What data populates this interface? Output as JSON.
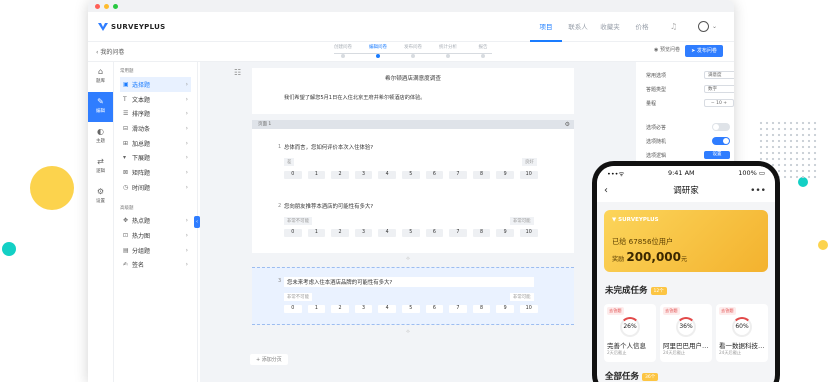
{
  "colors": {
    "accent": "#2f7dff",
    "yellow": "#fcc543",
    "teal": "#13d0c5",
    "red": "#e24a4a"
  },
  "app": {
    "logo": "SURVEYPLUS"
  },
  "topnav": {
    "tabs": [
      "项目",
      "联系人",
      "收藏夹",
      "价格"
    ],
    "active_tab": "项目"
  },
  "subbar": {
    "back_label": "我的问卷",
    "steps": [
      "创建问卷",
      "编辑问卷",
      "发布问卷",
      "统计分析",
      "报告"
    ],
    "active_step": "编辑问卷",
    "preview_label": "预览问卷",
    "publish_label": "发布问卷"
  },
  "leftnav": {
    "items": [
      {
        "label": "题库",
        "icon": "home-icon"
      },
      {
        "label": "编辑",
        "icon": "edit-icon"
      },
      {
        "label": "主题",
        "icon": "palette-icon"
      },
      {
        "label": "逻辑",
        "icon": "logic-icon"
      },
      {
        "label": "设置",
        "icon": "settings-icon"
      }
    ],
    "active": "编辑"
  },
  "qtypes": {
    "group1_title": "常用题",
    "group1": [
      {
        "label": "选择题",
        "icon": "radio-icon"
      },
      {
        "label": "文本题",
        "icon": "text-icon"
      },
      {
        "label": "排序题",
        "icon": "sort-icon"
      },
      {
        "label": "滑动条",
        "icon": "slider-icon"
      },
      {
        "label": "加总题",
        "icon": "sum-icon"
      },
      {
        "label": "下展题",
        "icon": "dropdown-icon"
      },
      {
        "label": "矩阵题",
        "icon": "matrix-icon"
      },
      {
        "label": "时间题",
        "icon": "clock-icon"
      }
    ],
    "group2_title": "高级题",
    "group2": [
      {
        "label": "热点题",
        "icon": "hotspot-icon"
      },
      {
        "label": "热力图",
        "icon": "heatmap-icon"
      },
      {
        "label": "分组题",
        "icon": "group-icon"
      },
      {
        "label": "签名",
        "icon": "signature-icon"
      }
    ],
    "active": "选择题"
  },
  "survey": {
    "title": "希尔顿酒店满意度调查",
    "description": "我们希望了解您5月1日在入住北京王府井希尔顿酒店的体验。",
    "page_label": "页面 1",
    "questions": [
      {
        "num": "1",
        "text": "总体而言，您如何评价本次入住体验?",
        "left_label": "差",
        "right_label": "良好"
      },
      {
        "num": "2",
        "text": "您向朋友推荐本酒店的可能性有多大?",
        "left_label": "非常不可能",
        "right_label": "非常可能"
      },
      {
        "num": "3",
        "text": "您未来考虑入住本酒店品牌的可能性有多大?",
        "left_label": "非常不可能",
        "right_label": "非常可能"
      }
    ],
    "scale": [
      "0",
      "1",
      "2",
      "3",
      "4",
      "5",
      "6",
      "7",
      "8",
      "9",
      "10"
    ],
    "add_page_label": "+ 添加分页"
  },
  "props": {
    "rows": [
      {
        "label": "常用选项",
        "value": "满意度"
      },
      {
        "label": "答题类型",
        "value": "数字"
      },
      {
        "label": "量程",
        "value": "10"
      }
    ],
    "toggles": [
      {
        "label": "选项必答",
        "on": false
      },
      {
        "label": "选项随机",
        "on": true
      }
    ],
    "logic_label": "选项逻辑",
    "logic_button": "设置"
  },
  "phone": {
    "time": "9:41 AM",
    "battery": "100%",
    "title": "调研家",
    "banner": {
      "logo": "SURVEYPLUS",
      "users_text": "已给 67856位用户",
      "prize_prefix": "奖励",
      "prize_value": "200,000",
      "prize_unit": "元"
    },
    "section_incomplete": "未完成任务",
    "incomplete_badge": "12个",
    "tasks": [
      {
        "tag": "去答题",
        "percent": "26%",
        "name": "完善个人信息",
        "date": "2天后截止"
      },
      {
        "tag": "去答题",
        "percent": "36%",
        "name": "阿里巴巴用户…",
        "date": "24天后截止"
      },
      {
        "tag": "去答题",
        "percent": "60%",
        "name": "看一数据科技…",
        "date": "24天后截止"
      }
    ],
    "section_all": "全部任务",
    "all_badge": "36个"
  }
}
